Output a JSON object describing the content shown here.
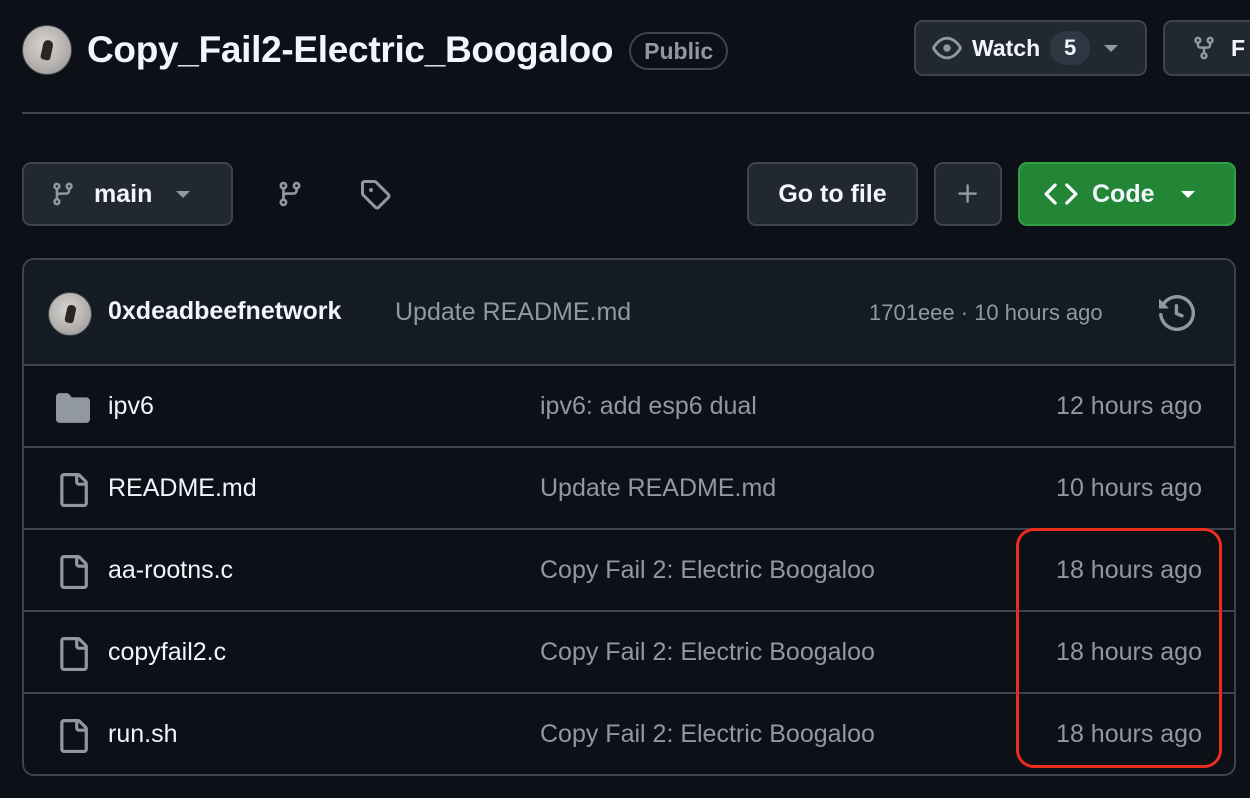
{
  "repo": {
    "name": "Copy_Fail2-Electric_Boogaloo",
    "visibility": "Public"
  },
  "actions": {
    "watch_label": "Watch",
    "watch_count": "5",
    "fork_label": "F"
  },
  "toolbar": {
    "branch": "main",
    "goto_file": "Go to file",
    "code_label": "Code"
  },
  "latest_commit": {
    "author": "0xdeadbeefnetwork",
    "message": "Update README.md",
    "meta": "1701eee · 10 hours ago"
  },
  "files": [
    {
      "name": "ipv6",
      "type": "folder",
      "message": "ipv6: add esp6 dual",
      "date": "12 hours ago"
    },
    {
      "name": "README.md",
      "type": "file",
      "message": "Update README.md",
      "date": "10 hours ago"
    },
    {
      "name": "aa-rootns.c",
      "type": "file",
      "message": "Copy Fail 2: Electric Boogaloo",
      "date": "18 hours ago"
    },
    {
      "name": "copyfail2.c",
      "type": "file",
      "message": "Copy Fail 2: Electric Boogaloo",
      "date": "18 hours ago"
    },
    {
      "name": "run.sh",
      "type": "file",
      "message": "Copy Fail 2: Electric Boogaloo",
      "date": "18 hours ago"
    }
  ],
  "colors": {
    "background": "#0d1117",
    "border": "#3d444d",
    "accent_green": "#238636",
    "muted_text": "#9198a1",
    "highlight_annotation": "#ea2d1f"
  }
}
